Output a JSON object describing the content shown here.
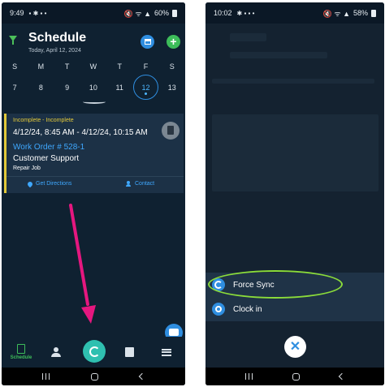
{
  "left": {
    "status": {
      "time": "9:49",
      "battery": "60%"
    },
    "header": {
      "title": "Schedule",
      "date": "Today, April 12, 2024"
    },
    "week": {
      "days": [
        "S",
        "M",
        "T",
        "W",
        "T",
        "F",
        "S"
      ],
      "dates": [
        "7",
        "8",
        "9",
        "10",
        "11",
        "12",
        "13"
      ],
      "selected_index": 5
    },
    "card": {
      "status": "Incomplete - Incomplete",
      "times": "4/12/24, 8:45 AM - 4/12/24, 10:15 AM",
      "work_order": "Work Order # 528-1",
      "customer": "Customer Support",
      "job_type": "Repair Job",
      "actions": {
        "directions": "Get Directions",
        "contact": "Contact"
      },
      "status_color": "#e3c93a"
    },
    "nav": {
      "schedule_label": "Schedule"
    },
    "annotation": {
      "arrow_color": "#e5177f"
    }
  },
  "right": {
    "status": {
      "time": "10:02",
      "battery": "58%"
    },
    "menu": {
      "force_sync": "Force Sync",
      "clock_in": "Clock in"
    },
    "annotation": {
      "highlight_color": "#8bdc3a"
    }
  },
  "icons": {
    "close": "✕",
    "add": "+"
  }
}
